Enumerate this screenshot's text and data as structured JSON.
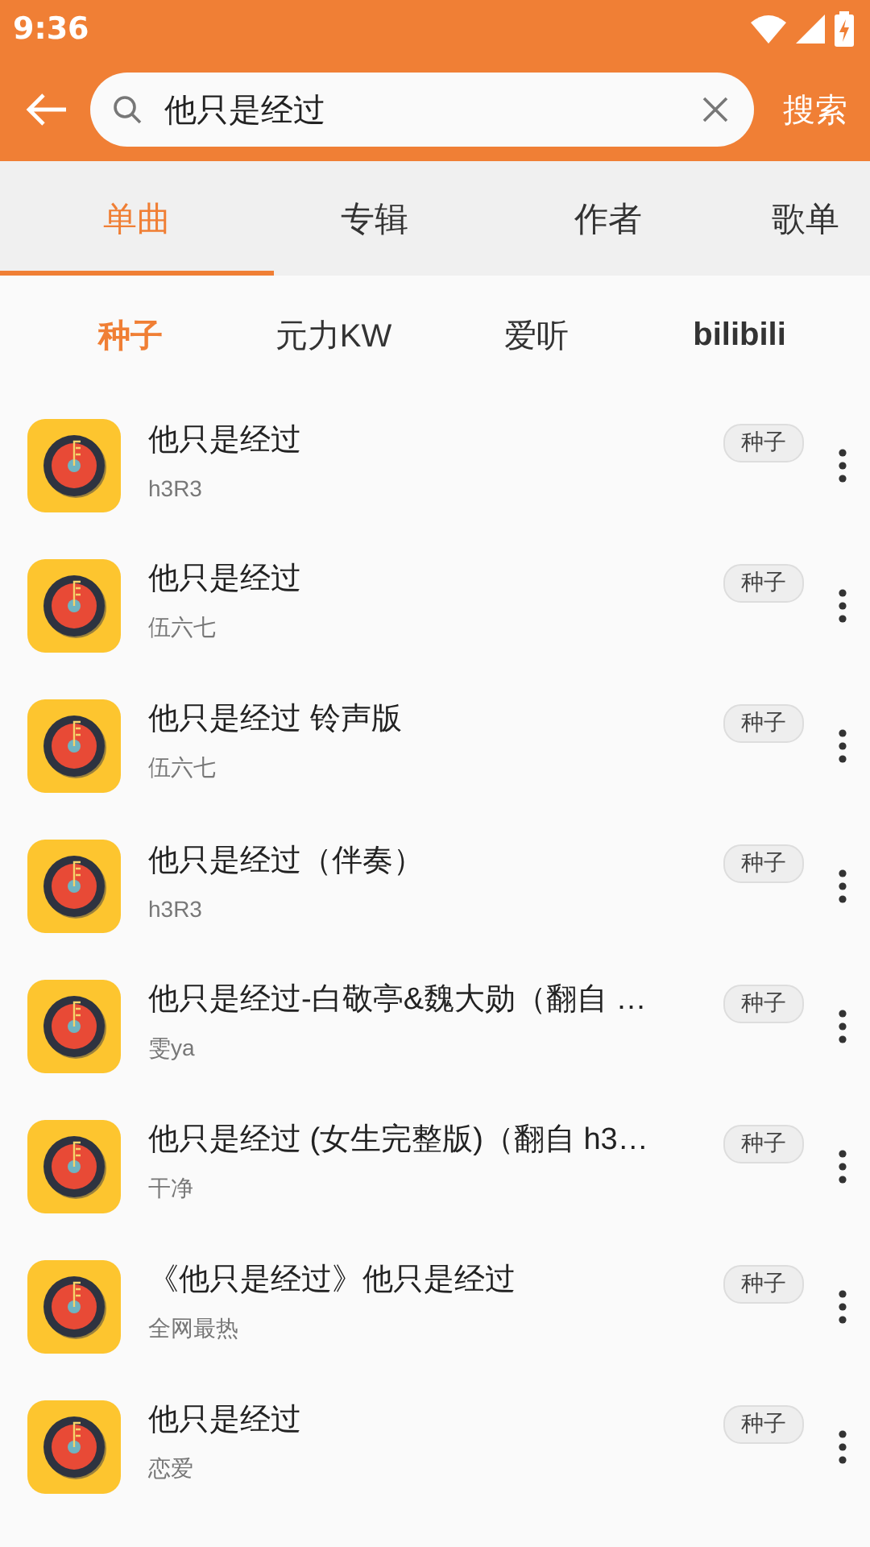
{
  "status_bar": {
    "time": "9:36"
  },
  "search": {
    "value": "他只是经过",
    "button": "搜索"
  },
  "tabs": [
    {
      "label": "单曲",
      "selected": true
    },
    {
      "label": "专辑",
      "selected": false
    },
    {
      "label": "作者",
      "selected": false
    },
    {
      "label": "歌单",
      "selected": false
    }
  ],
  "sources": [
    {
      "label": "种子",
      "selected": true
    },
    {
      "label": "元力KW",
      "selected": false
    },
    {
      "label": "爱听",
      "selected": false
    },
    {
      "label": "bilibili",
      "selected": false
    }
  ],
  "songs": [
    {
      "title": "他只是经过",
      "artist": "h3R3",
      "tag": "种子"
    },
    {
      "title": " 他只是经过",
      "artist": "伍六七",
      "tag": "种子"
    },
    {
      "title": "他只是经过 铃声版",
      "artist": "伍六七",
      "tag": "种子"
    },
    {
      "title": "他只是经过（伴奏）",
      "artist": "h3R3",
      "tag": "种子"
    },
    {
      "title": "他只是经过-白敬亭&魏大勋（翻自 …",
      "artist": "雯ya",
      "tag": "种子"
    },
    {
      "title": "他只是经过 (女生完整版)（翻自 h3…",
      "artist": "干净",
      "tag": "种子"
    },
    {
      "title": "《他只是经过》他只是经过",
      "artist": "全网最热",
      "tag": "种子"
    },
    {
      "title": "他只是经过",
      "artist": "恋爱",
      "tag": "种子"
    }
  ]
}
